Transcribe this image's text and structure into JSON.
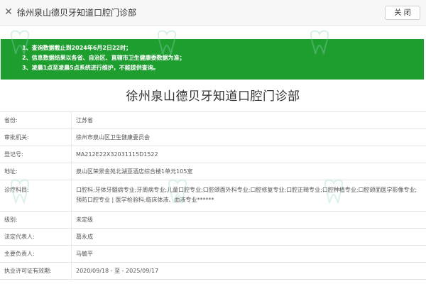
{
  "topbar": {
    "close_icon": "✕",
    "title": "徐州泉山德贝牙知道口腔门诊部",
    "close_button": "关 闭"
  },
  "notice": {
    "lines": [
      "1、查询数据截止到2024年6月2日22时；",
      "2、信息数据结果以各省、自治区、直辖市卫生健康委数据为准；",
      "3、凌晨1点至凌晨5点系统进行维护，不能提供查询。"
    ],
    "color": "#1e9e2f"
  },
  "main_title": "徐州泉山德贝牙知道口腔门诊部",
  "rows": [
    {
      "label": "省份:",
      "value": "江苏省"
    },
    {
      "label": "审批机关:",
      "value": "徐州市泉山区卫生健康委员会"
    },
    {
      "label": "登记号:",
      "value": "MA212E22X32031115D1522"
    },
    {
      "label": "地址:",
      "value": "泉山区荣景金苑北湖亚酒店综合楼1单元105室"
    },
    {
      "label": "诊疗科目:",
      "value": "口腔科;牙体牙髓病专业;牙周病专业;儿童口腔专业;口腔颌面外科专业;口腔修复专业;口腔正畸专业;口腔种植专业;口腔颌面医学影像专业;预防口腔专业 | 医学检验科;临床体液、血液专业******"
    },
    {
      "label": "级别:",
      "value": "未定级"
    },
    {
      "label": "法定代表人:",
      "value": "葛永成"
    },
    {
      "label": "主要负责人:",
      "value": "马毓平"
    },
    {
      "label": "执业许可证有效期:",
      "value": "2020/09/18 - 至 - 2025/09/17"
    }
  ]
}
